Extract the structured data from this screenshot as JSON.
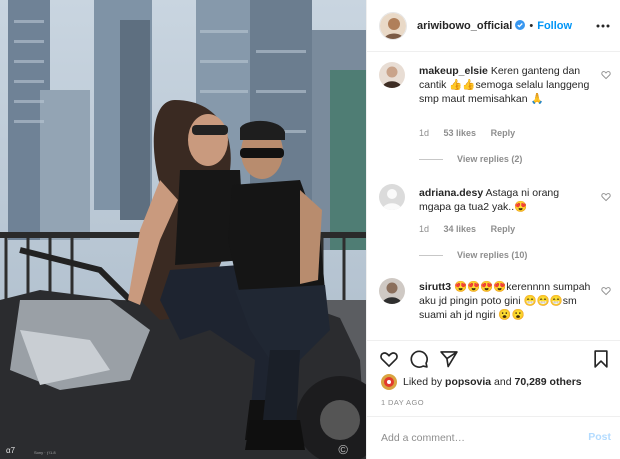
{
  "photo": {
    "watermark_left": "α7",
    "watermark_small": "Sony · ƒ/1.8",
    "watermark_copy": "©"
  },
  "header": {
    "username": "ariwibowo_official",
    "separator": "•",
    "follow_label": "Follow"
  },
  "comments": [
    {
      "username": "makeup_elsie",
      "text": "Keren ganteng dan cantik 👍👍semoga selalu langgeng smp maut memisahkan 🙏",
      "time": "1d",
      "likes": "53 likes",
      "reply": "Reply",
      "view_replies": "View replies (2)"
    },
    {
      "username": "adriana.desy",
      "text": "Astaga ni orang mgapa ga tua2 yak..😍",
      "time": "1d",
      "likes": "34 likes",
      "reply": "Reply",
      "view_replies": "View replies (10)"
    },
    {
      "username": "sirutt3",
      "text": "😍😍😍😍kerennnn sumpah aku jd pingin poto gini 😁😁😁sm suami ah jd ngiri 😮😮"
    }
  ],
  "likes": {
    "prefix": "Liked by",
    "user": "popsovia",
    "conj": "and",
    "others": "70,289 others"
  },
  "date": "1 DAY AGO",
  "add_comment": {
    "placeholder": "Add a comment…",
    "post_label": "Post"
  },
  "colors": {
    "link_blue": "#0095f6",
    "muted_grey": "#8e8e8e",
    "border": "#efefef",
    "post_disabled": "#b3dbff"
  },
  "icons": {
    "verified": "verified-badge-icon",
    "more": "more-options-icon",
    "heart": "heart-icon",
    "comment": "comment-icon",
    "share": "share-icon",
    "save": "bookmark-icon"
  }
}
